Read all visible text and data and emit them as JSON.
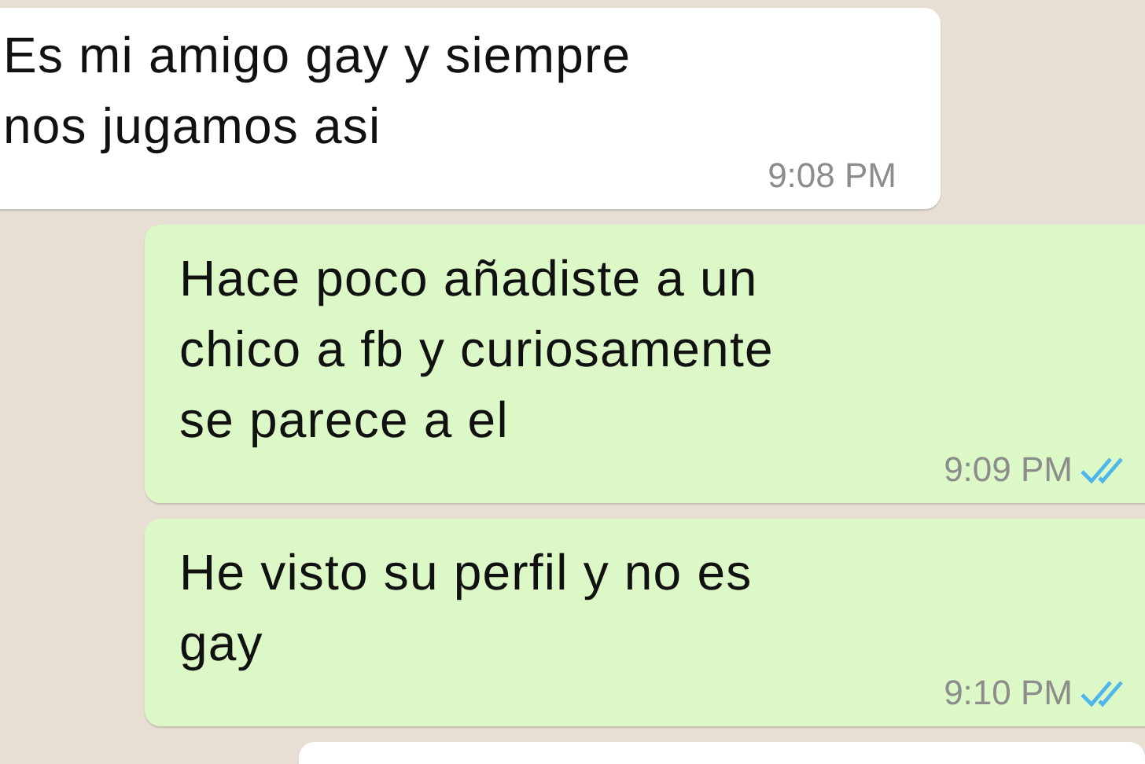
{
  "messages": [
    {
      "kind": "incoming",
      "lines": [
        "Es mi amigo gay y siempre",
        "nos jugamos asi"
      ],
      "time": "9:08 PM"
    },
    {
      "kind": "outgoing",
      "lines": [
        "Hace poco añadiste a un",
        "chico a fb y curiosamente",
        "se parece a el"
      ],
      "time": "9:09 PM",
      "read": true
    },
    {
      "kind": "outgoing",
      "lines": [
        "He visto su perfil y no es",
        "gay"
      ],
      "time": "9:10 PM",
      "read": true
    },
    {
      "kind": "incoming"
    }
  ]
}
